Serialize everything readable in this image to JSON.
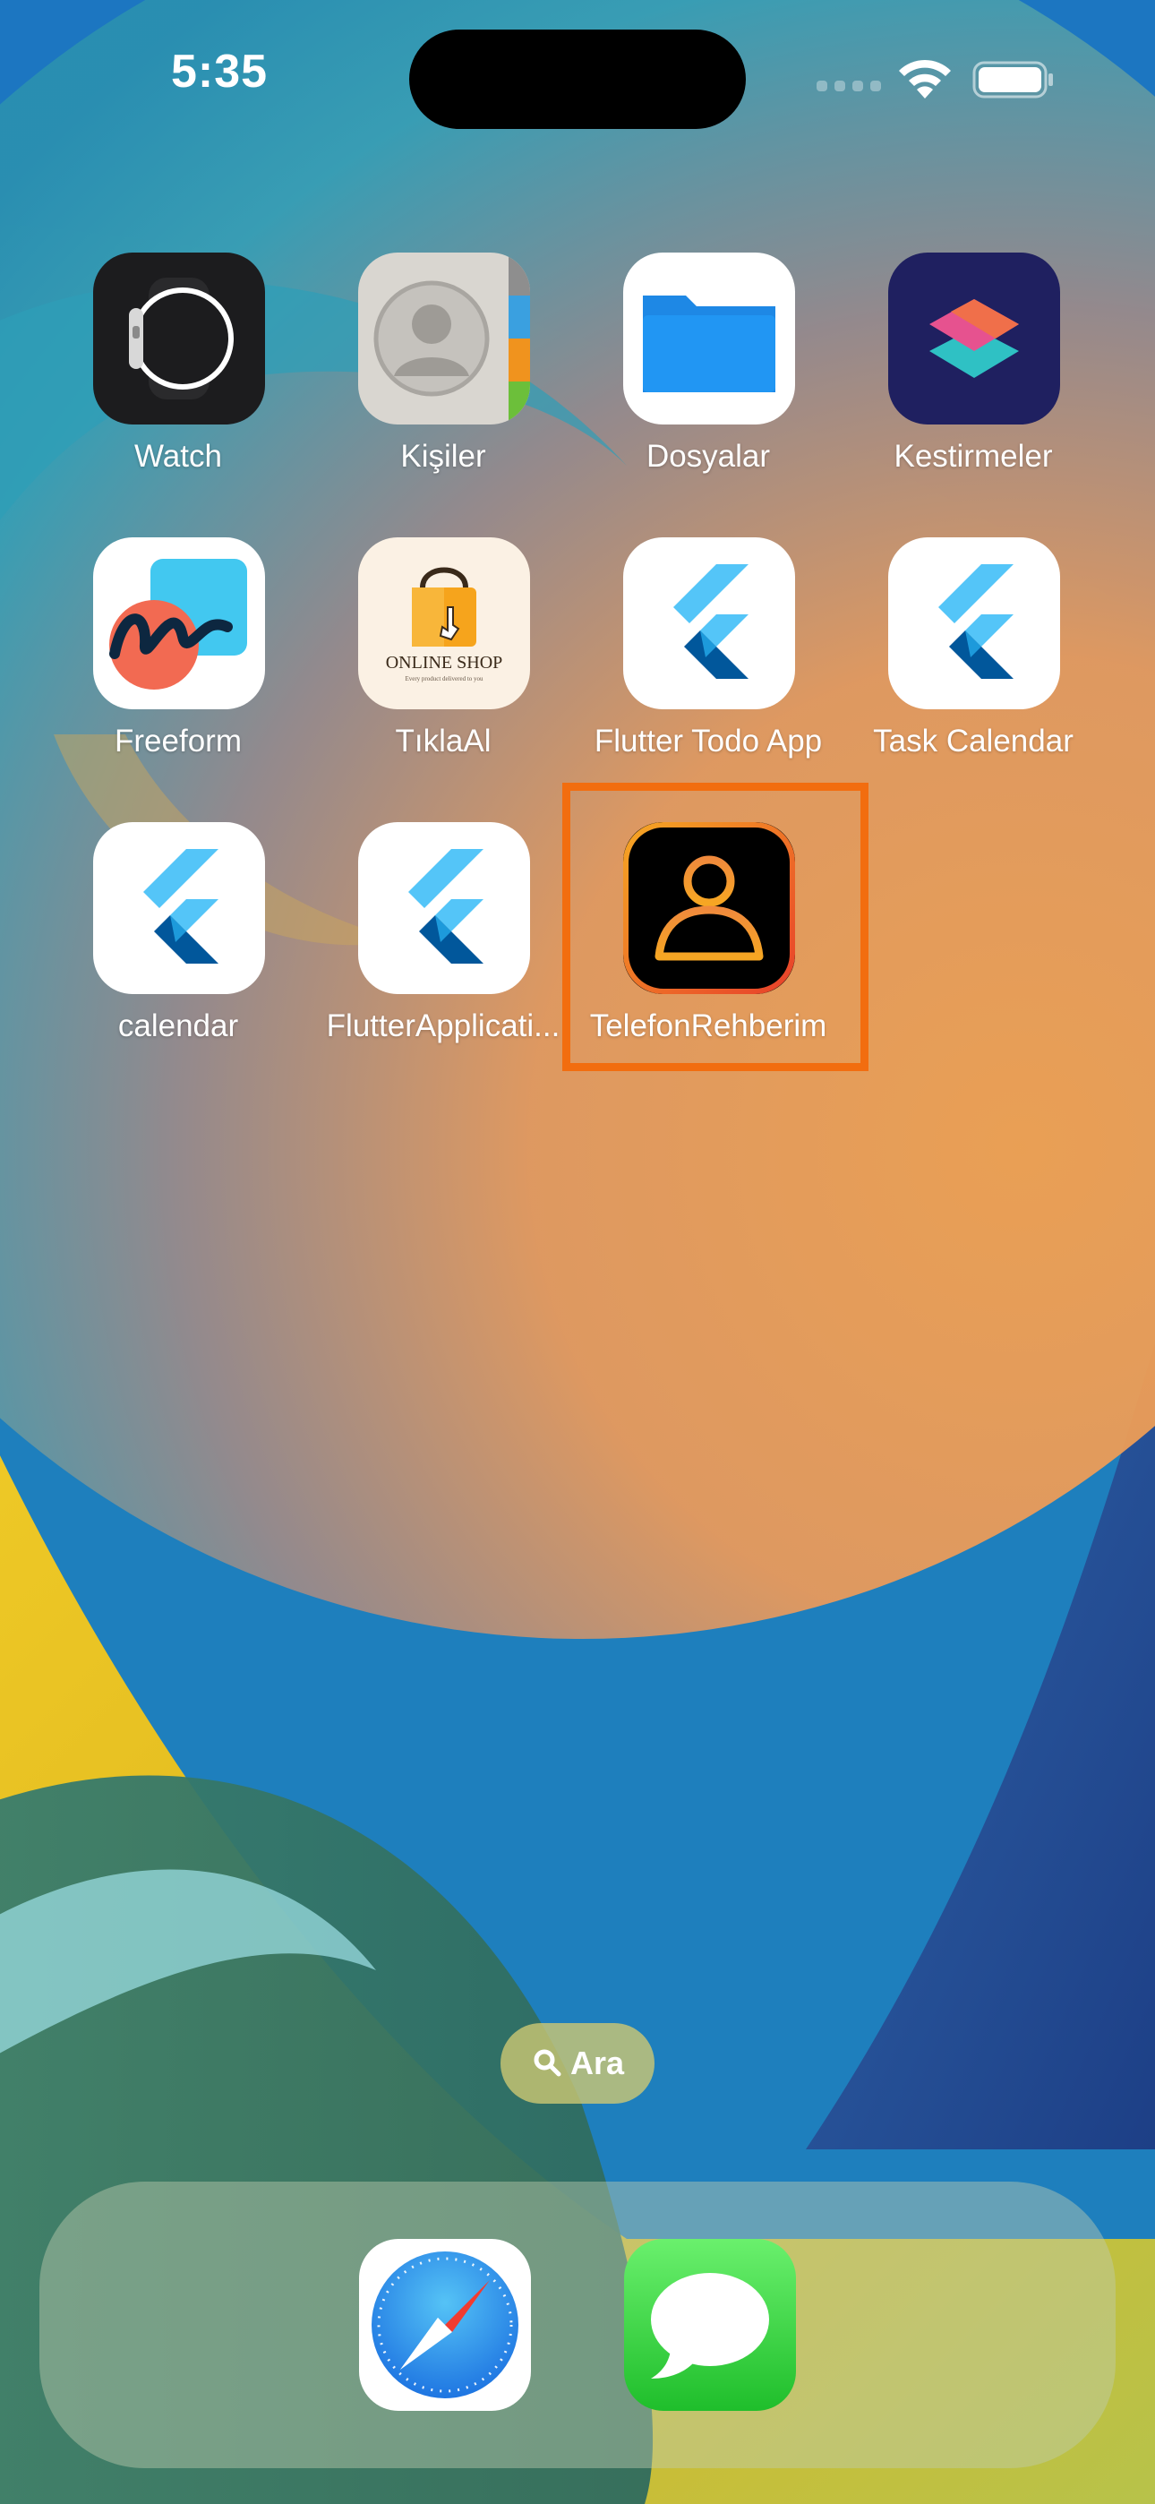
{
  "status_bar": {
    "time": "5:35"
  },
  "home_screen": {
    "apps": [
      {
        "label": "Watch",
        "icon": "watch-icon"
      },
      {
        "label": "Kişiler",
        "icon": "contacts-icon"
      },
      {
        "label": "Dosyalar",
        "icon": "files-folder-icon"
      },
      {
        "label": "Kestirmeler",
        "icon": "shortcuts-icon"
      },
      {
        "label": "Freeform",
        "icon": "freeform-icon"
      },
      {
        "label": "TıklaAl",
        "icon": "shopping-bag-icon",
        "icon_text": "ONLINE SHOP",
        "icon_subtext": "Every product delivered to you"
      },
      {
        "label": "Flutter Todo App",
        "icon": "flutter-logo-icon"
      },
      {
        "label": "Task Calendar",
        "icon": "flutter-logo-icon"
      },
      {
        "label": "calendar",
        "icon": "flutter-logo-icon"
      },
      {
        "label": "FlutterApplicati...",
        "icon": "flutter-logo-icon"
      },
      {
        "label": "TelefonRehberim",
        "icon": "person-icon",
        "highlighted": true
      }
    ]
  },
  "search": {
    "label": "Ara",
    "icon": "search-icon"
  },
  "dock": {
    "apps": [
      {
        "name": "Safari",
        "icon": "safari-compass-icon"
      },
      {
        "name": "Messages",
        "icon": "messages-bubble-icon"
      }
    ]
  },
  "colors": {
    "highlight": "#f26d0f",
    "flutter_light": "#54c5f8",
    "flutter_dark": "#01579b"
  }
}
